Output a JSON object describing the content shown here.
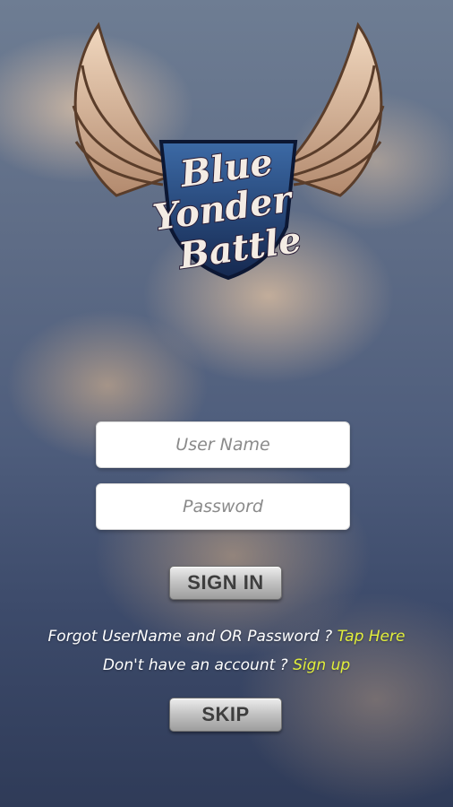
{
  "logo": {
    "line1": "Blue",
    "line2": "Yonder",
    "line3": "Battle"
  },
  "login": {
    "username_placeholder": "User Name",
    "password_placeholder": "Password",
    "sign_in_label": "SIGN IN"
  },
  "forgot": {
    "text": "Forgot UserName and OR Password ?",
    "link": "Tap Here"
  },
  "signup": {
    "text": "Don't have an account ?",
    "link": "Sign up"
  },
  "skip_label": "SKIP",
  "colors": {
    "link": "#e2ef3b",
    "shield": "#1f3d76"
  }
}
